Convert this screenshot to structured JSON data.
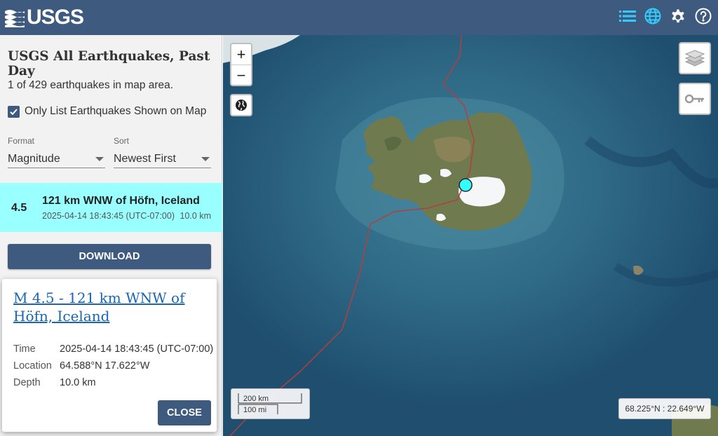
{
  "header": {
    "logo_text": "USGS",
    "icons": [
      "list-icon",
      "globe-icon",
      "gear-icon",
      "help-icon"
    ]
  },
  "sidebar": {
    "title": "USGS All Earthquakes, Past Day",
    "count_text": "1 of 429 earthquakes in map area.",
    "only_list_label": "Only List Earthquakes Shown on Map",
    "only_list_checked": true,
    "format": {
      "label": "Format",
      "value": "Magnitude"
    },
    "sort": {
      "label": "Sort",
      "value": "Newest First"
    },
    "earthquakes": [
      {
        "magnitude": "4.5",
        "place": "121 km WNW of Höfn, Iceland",
        "time": "2025-04-14 18:43:45 (UTC-07:00)",
        "depth": "10.0 km"
      }
    ],
    "download_label": "DOWNLOAD"
  },
  "popup": {
    "title": "M 4.5 - 121 km WNW of Höfn, Iceland",
    "time_label": "Time",
    "time_value": "2025-04-14 18:43:45 (UTC-07:00)",
    "location_label": "Location",
    "location_value": "64.588°N 17.622°W",
    "depth_label": "Depth",
    "depth_value": "10.0 km",
    "close_label": "CLOSE"
  },
  "map": {
    "zoom_in": "+",
    "zoom_out": "−",
    "scale_km": "200 km",
    "scale_mi": "100 mi",
    "coordinates": "68.225°N : 22.649°W",
    "marker_color": "#33ffff",
    "plate_boundary_color": "#b04040"
  },
  "colors": {
    "header_bg": "#3e5a7e",
    "selected_row": "#99ffff",
    "link": "#1a66b3",
    "icon_accent": "#33ccff"
  }
}
